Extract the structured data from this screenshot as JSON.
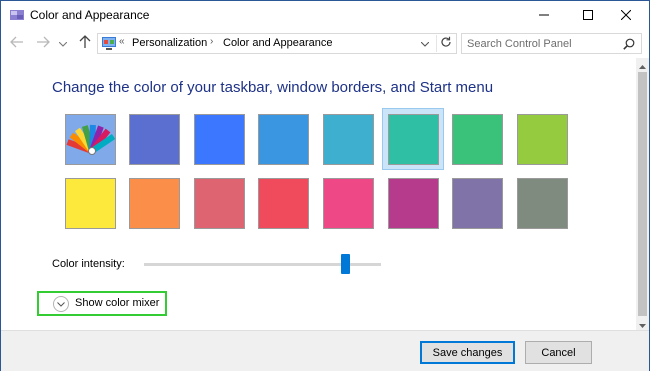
{
  "window": {
    "title": "Color and Appearance",
    "icons": {
      "app": "color-palette-icon",
      "minimize": "minimize-icon",
      "maximize": "maximize-icon",
      "close": "close-icon"
    }
  },
  "navigation": {
    "icons": {
      "back": "arrow-left-icon",
      "forward": "arrow-right-icon",
      "recent": "chevron-down-icon",
      "up": "arrow-up-icon"
    },
    "address": {
      "icon": "control-panel-icon",
      "lead_separator": "«",
      "separator": "›",
      "breadcrumbs": [
        "Personalization",
        "Color and Appearance"
      ],
      "refresh_icon": "refresh-icon"
    },
    "search": {
      "placeholder": "Search Control Panel",
      "value": "",
      "icon": "search-icon"
    }
  },
  "main": {
    "heading": "Change the color of your taskbar, window borders, and Start menu",
    "colors": {
      "selected_index": 5,
      "automatic_icon": "automatic-color-fan-icon",
      "swatches": [
        "automatic",
        "#5a6fd0",
        "#3b78ff",
        "#3a96e0",
        "#3fafd0",
        "#2fbfa5",
        "#3bc27a",
        "#95cc3f",
        "#fde83c",
        "#fb8e48",
        "#dd6470",
        "#ef4b5d",
        "#ef4886",
        "#b73b8c",
        "#7f73a8",
        "#7e8b7e"
      ]
    },
    "intensity": {
      "label": "Color intensity:",
      "value_percent": 85
    },
    "mixer": {
      "label": "Show color mixer",
      "icon": "expand-circle-chevron-icon",
      "highlight": "#33cc33"
    }
  },
  "footer": {
    "save_label": "Save changes",
    "cancel_label": "Cancel"
  },
  "colors": {
    "accent": "#0078d7",
    "heading": "#1e3287",
    "selection_bg": "#cce4f7",
    "footer_bg": "#f0f0f0"
  }
}
